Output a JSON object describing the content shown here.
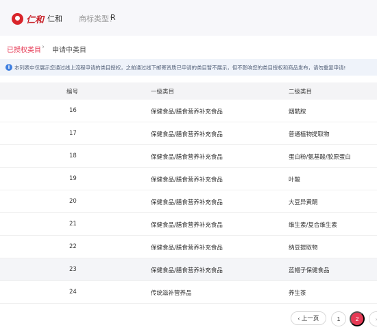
{
  "header": {
    "logo_text": "仁和",
    "shop_name": "仁和",
    "type_label": "商标类型：",
    "type_value": "R"
  },
  "tabs": {
    "active": "已授权类目",
    "separator": "›",
    "inactive": "申请中类目"
  },
  "notice": {
    "icon": "i",
    "text": "本列表中仅展示您通过线上流程申请的类目授权，之前通过线下邮寄资质已申请的类目暂不展示，但不影响您的类目授权和商品发布，请勿重复申请!"
  },
  "table": {
    "headers": [
      "编号",
      "一级类目",
      "二级类目"
    ],
    "rows": [
      {
        "id": "16",
        "level1": "保健食品/膳食营养补充食品",
        "level2": "烟酰胺"
      },
      {
        "id": "17",
        "level1": "保健食品/膳食营养补充食品",
        "level2": "普通植物提取物"
      },
      {
        "id": "18",
        "level1": "保健食品/膳食营养补充食品",
        "level2": "蛋白粉/氨基酸/胶原蛋白"
      },
      {
        "id": "19",
        "level1": "保健食品/膳食营养补充食品",
        "level2": "叶酸"
      },
      {
        "id": "20",
        "level1": "保健食品/膳食营养补充食品",
        "level2": "大豆异黄酮"
      },
      {
        "id": "21",
        "level1": "保健食品/膳食营养补充食品",
        "level2": "维生素/复合维生素"
      },
      {
        "id": "22",
        "level1": "保健食品/膳食营养补充食品",
        "level2": "纳豆提取物"
      },
      {
        "id": "23",
        "level1": "保健食品/膳食营养补充食品",
        "level2": "蓝帽子保健食品"
      },
      {
        "id": "24",
        "level1": "传统滋补营养品",
        "level2": "养生茶"
      }
    ]
  },
  "pagination": {
    "prev_label": "‹ 上一页",
    "pages": [
      "1",
      "2"
    ],
    "current_page": "2",
    "next_glyph": "›"
  },
  "colors": {
    "accent": "#e63a55",
    "logo_red": "#d9252b",
    "info_blue": "#3f7fe0"
  }
}
